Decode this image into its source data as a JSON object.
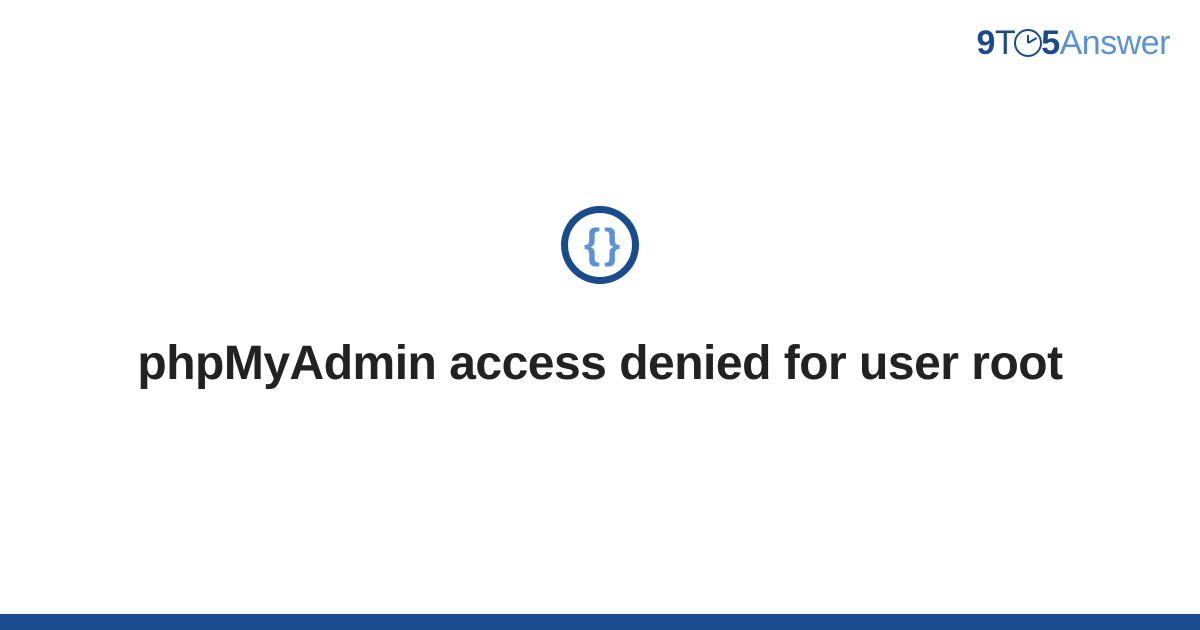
{
  "brand": {
    "part_9": "9",
    "part_t": "T",
    "part_5": "5",
    "part_answer": "Answer"
  },
  "icon": {
    "name": "code-braces-icon",
    "glyph": "{ }"
  },
  "title": "phpMyAdmin access denied for user root",
  "colors": {
    "primary": "#1a4b8c",
    "accent": "#5a92d4",
    "text": "#222222",
    "background": "#ffffff"
  }
}
